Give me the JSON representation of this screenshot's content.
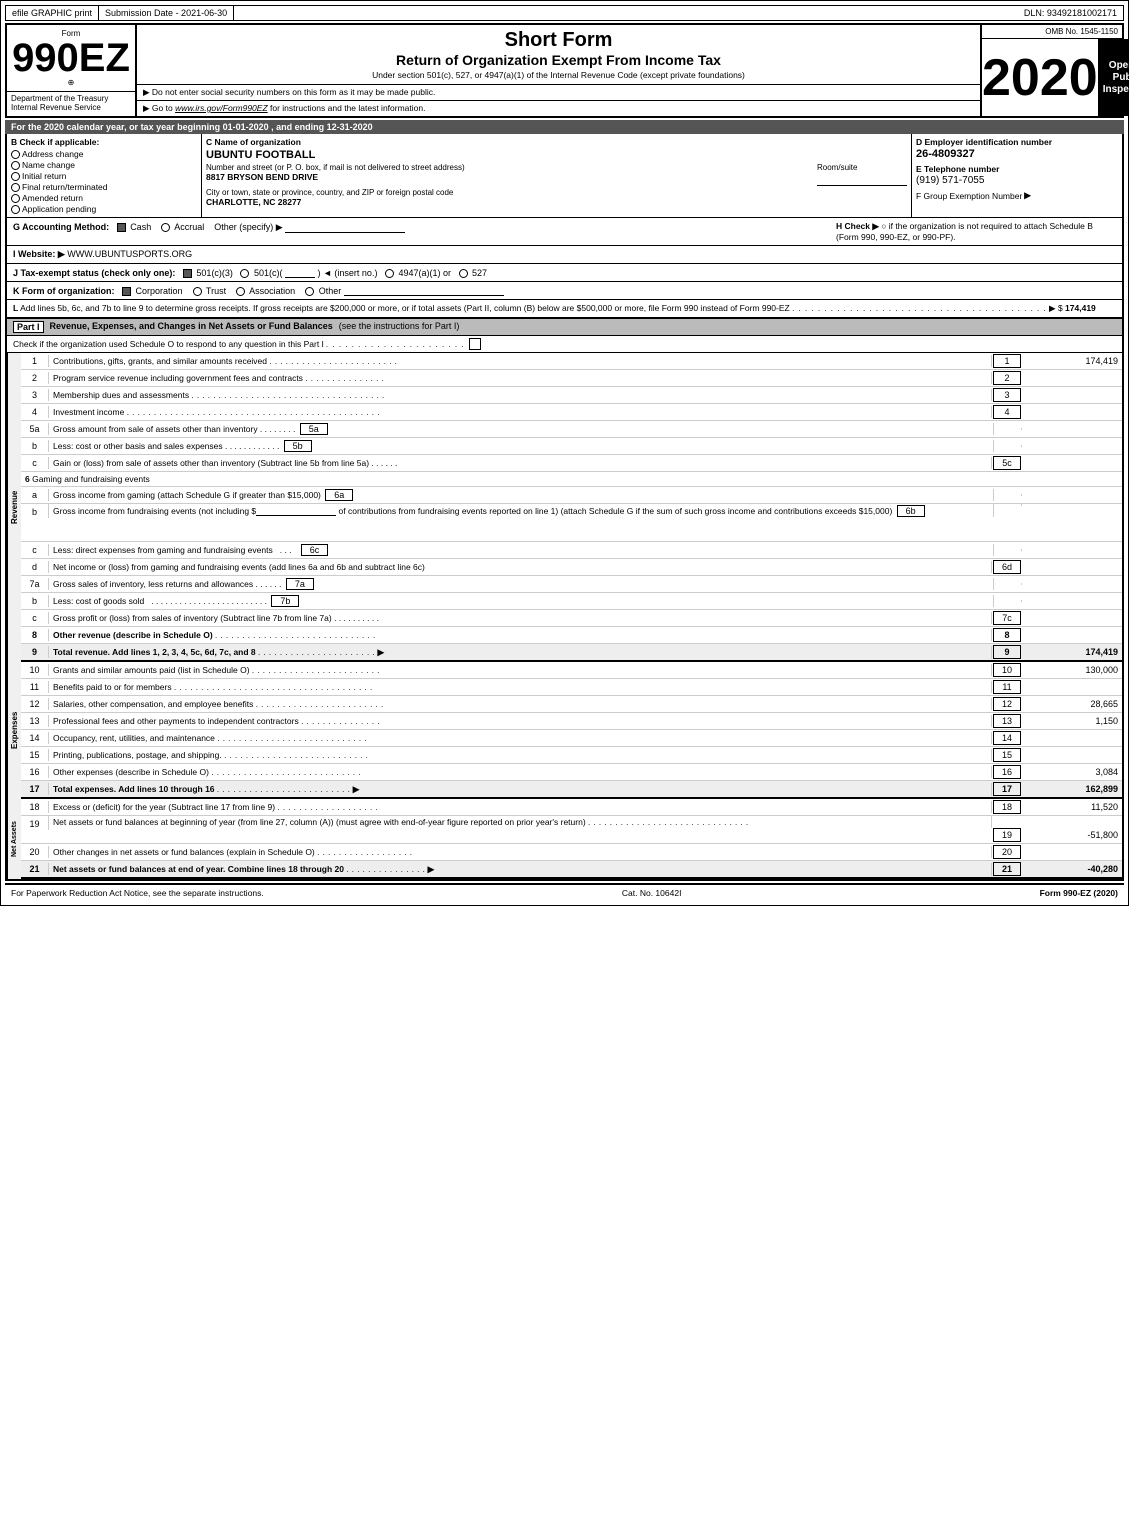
{
  "topBar": {
    "efile": "efile GRAPHIC print",
    "submission": "Submission Date - 2021-06-30",
    "dln": "DLN: 93492181002171"
  },
  "header": {
    "formLabel": "Form",
    "formNumber": "990EZ",
    "formSub": "⊕",
    "title1": "Short Form",
    "title2": "Return of Organization Exempt From Income Tax",
    "subtitle": "Under section 501(c), 527, or 4947(a)(1) of the Internal Revenue Code (except private foundations)",
    "notice1": "▶ Do not enter social security numbers on this form as it may be made public.",
    "notice2": "▶ Go to www.irs.gov/Form990EZ for instructions and the latest information.",
    "notice2link": "www.irs.gov/Form990EZ",
    "year": "2020",
    "openTitle": "Open to Public Inspection",
    "ombNo": "OMB No. 1545-1150"
  },
  "dept": {
    "dept": "Department of the Treasury",
    "irs": "Internal Revenue Service"
  },
  "yearLine": "For the 2020 calendar year, or tax year beginning 01-01-2020 , and ending 12-31-2020",
  "checkSection": {
    "bLabel": "B Check if applicable:",
    "checks": [
      {
        "id": "address",
        "label": "Address change",
        "checked": false
      },
      {
        "id": "name",
        "label": "Name change",
        "checked": false
      },
      {
        "id": "initial",
        "label": "Initial return",
        "checked": false
      },
      {
        "id": "final",
        "label": "Final return/terminated",
        "checked": false
      },
      {
        "id": "amended",
        "label": "Amended return",
        "checked": false
      },
      {
        "id": "pending",
        "label": "Application pending",
        "checked": false
      }
    ],
    "cLabel": "C Name of organization",
    "orgName": "UBUNTU FOOTBALL",
    "streetLabel": "Number and street (or P. O. box, if mail is not delivered to street address)",
    "streetValue": "8817 BRYSON BEND DRIVE",
    "roomLabel": "Room/suite",
    "roomValue": "",
    "cityLabel": "City or town, state or province, country, and ZIP or foreign postal code",
    "cityValue": "CHARLOTTE, NC  28277",
    "dLabel": "D Employer identification number",
    "ein": "26-4809327",
    "eLabel": "E Telephone number",
    "phone": "(919) 571-7055",
    "fLabel": "F Group Exemption Number",
    "groupNum": ""
  },
  "gRow": {
    "gLabel": "G Accounting Method:",
    "cashChecked": true,
    "cashLabel": "Cash",
    "accrualChecked": false,
    "accrualLabel": "Accrual",
    "otherLabel": "Other (specify) ▶",
    "hLabel": "H Check ▶",
    "hText": "○ if the organization is not required to attach Schedule B (Form 990, 990-EZ, or 990-PF)."
  },
  "iRow": {
    "label": "I Website: ▶",
    "value": "WWW.UBUNTUSPORTS.ORG"
  },
  "jRow": {
    "label": "J Tax-exempt status (check only one):",
    "options": [
      {
        "id": "501c3",
        "label": "501(c)(3)",
        "checked": true
      },
      {
        "id": "501c",
        "label": "501(c)(",
        "checked": false
      },
      {
        "id": "insert",
        "label": ") ◄ (insert no.)",
        "checked": false
      },
      {
        "id": "4947a1",
        "label": "4947(a)(1) or",
        "checked": false
      },
      {
        "id": "527",
        "label": "527",
        "checked": false
      }
    ]
  },
  "kRow": {
    "label": "K Form of organization:",
    "options": [
      {
        "id": "corp",
        "label": "Corporation",
        "checked": true
      },
      {
        "id": "trust",
        "label": "Trust",
        "checked": false
      },
      {
        "id": "assoc",
        "label": "Association",
        "checked": false
      },
      {
        "id": "other",
        "label": "Other",
        "checked": false
      }
    ]
  },
  "lRow": {
    "text": "L Add lines 5b, 6c, and 7b to line 9 to determine gross receipts. If gross receipts are $200,000 or more, or if total assets (Part II, column (B) below are $500,000 or more, file Form 990 instead of Form 990-EZ",
    "dots": ". . . . . . . . . . . . . . . . . . . . . . . . . . . . . . . . . . . . . . . .",
    "arrow": "▶ $",
    "value": "174,419"
  },
  "part1": {
    "label": "Part I",
    "title": "Revenue, Expenses, and Changes in Net Assets or Fund Balances",
    "titleNote": "(see the instructions for Part I)",
    "checkLine": "Check if the organization used Schedule O to respond to any question in this Part I",
    "dots": ". . . . . . . . . . . . . . . . . . . . . .",
    "rows": [
      {
        "num": "1",
        "label": "Contributions, gifts, grants, and similar amounts received",
        "dots": ". . . . . . . . . . . . . . . . . . . . . . .",
        "numRight": "1",
        "value": "174,419"
      },
      {
        "num": "2",
        "label": "Program service revenue including government fees and contracts",
        "dots": ". . . . . . . . . . . . . . .",
        "numRight": "2",
        "value": ""
      },
      {
        "num": "3",
        "label": "Membership dues and assessments",
        "dots": ". . . . . . . . . . . . . . . . . . . . . . . . . . . . . . . . . . . .",
        "numRight": "3",
        "value": ""
      },
      {
        "num": "4",
        "label": "Investment income",
        "dots": ". . . . . . . . . . . . . . . . . . . . . . . . . . . . . . . . . . . . . . . . . . . . . . .",
        "numRight": "4",
        "value": ""
      },
      {
        "num": "5a",
        "label": "Gross amount from sale of assets other than inventory . . . . . . . .",
        "subBox": "5a",
        "numRight": "",
        "value": ""
      },
      {
        "num": "b",
        "label": "Less: cost or other basis and sales expenses . . . . . . . . . . . .",
        "subBox": "5b",
        "numRight": "",
        "value": ""
      },
      {
        "num": "c",
        "label": "Gain or (loss) from sale of assets other than inventory (Subtract line 5b from line 5a) . . . . . .",
        "numRight": "5c",
        "value": ""
      }
    ],
    "gamingLabel": "6  Gaming and fundraising events",
    "gamingRows": [
      {
        "num": "a",
        "label": "Gross income from gaming (attach Schedule G if greater than $15,000)",
        "subBox": "6a",
        "value": ""
      },
      {
        "num": "b",
        "label": "Gross income from fundraising events (not including $",
        "blank": "________________",
        "label2": " of contributions from fundraising events reported on line 1) (attach Schedule G if the sum of such gross income and contributions exceeds $15,000)",
        "subBox": "6b",
        "value": ""
      },
      {
        "num": "c",
        "label": "Less: direct expenses from gaming and fundraising events . . . .",
        "subBox": "6c",
        "value": ""
      },
      {
        "num": "d",
        "label": "Net income or (loss) from gaming and fundraising events (add lines 6a and 6b and subtract line 6c)",
        "numRight": "6d",
        "value": ""
      }
    ],
    "inventoryRows": [
      {
        "num": "7a",
        "label": "Gross sales of inventory, less returns and allowances . . . . . .",
        "subBox": "7a",
        "value": ""
      },
      {
        "num": "b",
        "label": "Less: cost of goods sold . . . . . . . . . . . . . . . . . . .",
        "subBox": "7b",
        "value": ""
      },
      {
        "num": "c",
        "label": "Gross profit or (loss) from sales of inventory (Subtract line 7b from line 7a) . . . . . . . . . .",
        "numRight": "7c",
        "value": ""
      }
    ],
    "row8": {
      "num": "8",
      "label": "Other revenue (describe in Schedule O)",
      "dots": ". . . . . . . . . . . . . . . . . . . . . . . . . . . . . .",
      "numRight": "8",
      "value": ""
    },
    "row9": {
      "num": "9",
      "label": "Total revenue. Add lines 1, 2, 3, 4, 5c, 6d, 7c, and 8",
      "dots": ". . . . . . . . . . . . . . . . . . . . . .",
      "arrow": "▶",
      "numRight": "9",
      "value": "174,419"
    }
  },
  "expenses": {
    "rows": [
      {
        "num": "10",
        "label": "Grants and similar amounts paid (list in Schedule O)",
        "dots": ". . . . . . . . . . . . . . . . . . . . . . . .",
        "numRight": "10",
        "value": "130,000"
      },
      {
        "num": "11",
        "label": "Benefits paid to or for members",
        "dots": ". . . . . . . . . . . . . . . . . . . . . . . . . . . . . . . . . . . . .",
        "numRight": "11",
        "value": ""
      },
      {
        "num": "12",
        "label": "Salaries, other compensation, and employee benefits",
        "dots": ". . . . . . . . . . . . . . . . . . . . . . . .",
        "numRight": "12",
        "value": "28,665"
      },
      {
        "num": "13",
        "label": "Professional fees and other payments to independent contractors",
        "dots": ". . . . . . . . . . . . . . .",
        "numRight": "13",
        "value": "1,150"
      },
      {
        "num": "14",
        "label": "Occupancy, rent, utilities, and maintenance",
        "dots": ". . . . . . . . . . . . . . . . . . . . . . . . . . . . .",
        "numRight": "14",
        "value": ""
      },
      {
        "num": "15",
        "label": "Printing, publications, postage, and shipping.",
        "dots": ". . . . . . . . . . . . . . . . . . . . . . . . . . .",
        "numRight": "15",
        "value": ""
      },
      {
        "num": "16",
        "label": "Other expenses (describe in Schedule O)",
        "dots": ". . . . . . . . . . . . . . . . . . . . . . . . . . . . .",
        "numRight": "16",
        "value": "3,084"
      },
      {
        "num": "17",
        "label": "Total expenses. Add lines 10 through 16",
        "dots": ". . . . . . . . . . . . . . . . . . . . . . . . .",
        "arrow": "▶",
        "numRight": "17",
        "value": "162,899"
      }
    ]
  },
  "netAssets": {
    "rows": [
      {
        "num": "18",
        "label": "Excess or (deficit) for the year (Subtract line 17 from line 9)",
        "dots": ". . . . . . . . . . . . . . . . . . .",
        "numRight": "18",
        "value": "11,520"
      },
      {
        "num": "19",
        "label": "Net assets or fund balances at beginning of year (from line 27, column (A)) (must agree with end-of-year figure reported on prior year's return)",
        "dots": ". . . . . . . . . . . . . . . . . . . . . . . . . . . . . .",
        "numRight": "19",
        "value": "-51,800"
      },
      {
        "num": "20",
        "label": "Other changes in net assets or fund balances (explain in Schedule O)",
        "dots": ". . . . . . . . . . . . . . . . . .",
        "numRight": "20",
        "value": ""
      },
      {
        "num": "21",
        "label": "Net assets or fund balances at end of year. Combine lines 18 through 20",
        "dots": ". . . . . . . . . . . . . . . .",
        "arrow": "▶",
        "numRight": "21",
        "value": "-40,280"
      }
    ]
  },
  "footer": {
    "paperwork": "For Paperwork Reduction Act Notice, see the separate instructions.",
    "cat": "Cat. No. 10642I",
    "form": "Form 990-EZ (2020)"
  }
}
